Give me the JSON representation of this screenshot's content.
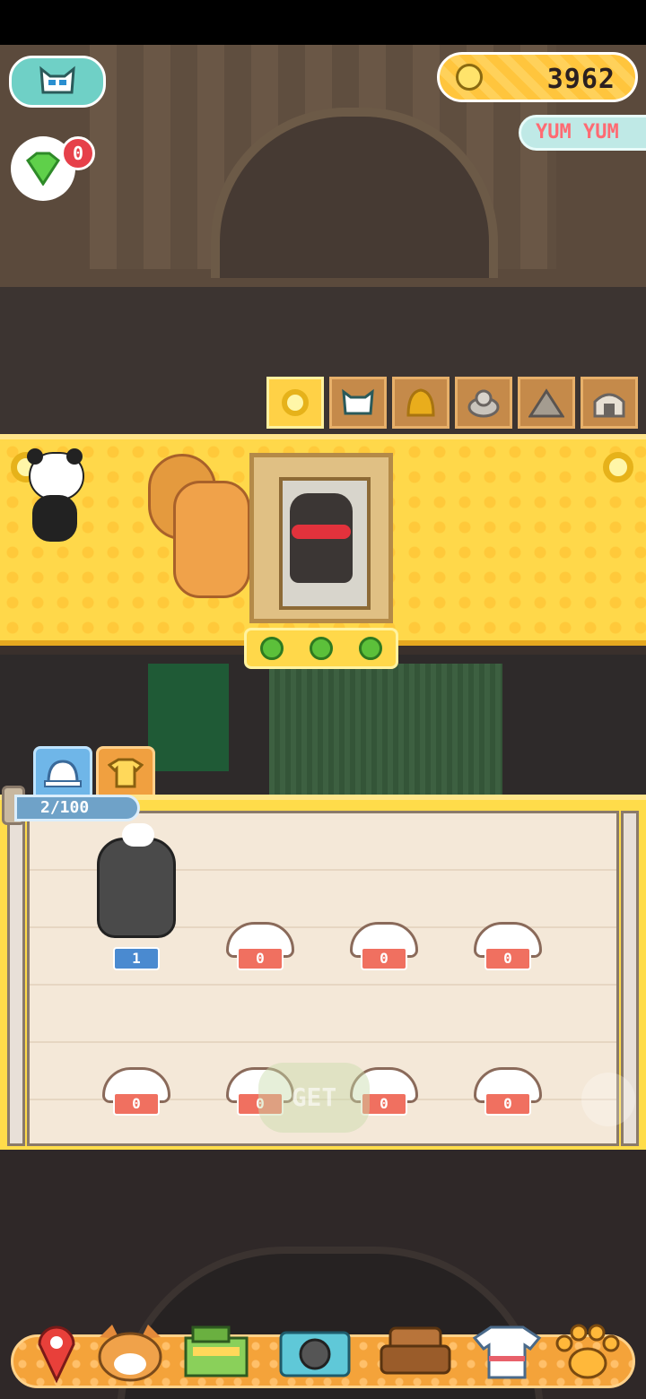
{
  "hud": {
    "coins": "3962",
    "gems_badge": "0",
    "banner": "YUM YUM"
  },
  "category_tabs": [
    {
      "icon": "ring-icon",
      "active": true
    },
    {
      "icon": "cat-mask-icon",
      "active": false
    },
    {
      "icon": "bell-icon",
      "active": false
    },
    {
      "icon": "rock-pile-icon",
      "active": false
    },
    {
      "icon": "mountain-icon",
      "active": false
    },
    {
      "icon": "hut-icon",
      "active": false
    }
  ],
  "display": {
    "ring_left": "ring-icon",
    "ring_right": "ring-icon",
    "stars_icons": [
      "flower-token-icon",
      "flower-token-icon",
      "flower-token-icon"
    ]
  },
  "inventory": {
    "tabs": [
      {
        "icon": "hat-icon",
        "active": true
      },
      {
        "icon": "shirt-icon",
        "active": false
      }
    ],
    "count": "2/100",
    "slots_row1": [
      "1",
      "0",
      "0",
      "0"
    ],
    "slots_row2": [
      "0",
      "0",
      "0",
      "0"
    ]
  },
  "ghost_button": "GET",
  "nav": [
    {
      "icon": "map-pin-icon"
    },
    {
      "icon": "shiba-face-icon"
    },
    {
      "icon": "cash-register-icon"
    },
    {
      "icon": "camera-icon"
    },
    {
      "icon": "armchair-icon"
    },
    {
      "icon": "outfit-icon"
    },
    {
      "icon": "paw-icon"
    }
  ],
  "colors": {
    "panel_yellow": "#ffd84a",
    "tab_orange": "#f0a040",
    "nav_orange": "#f4a33a",
    "badge_red": "#e6404a",
    "teal": "#6fd0c6"
  }
}
